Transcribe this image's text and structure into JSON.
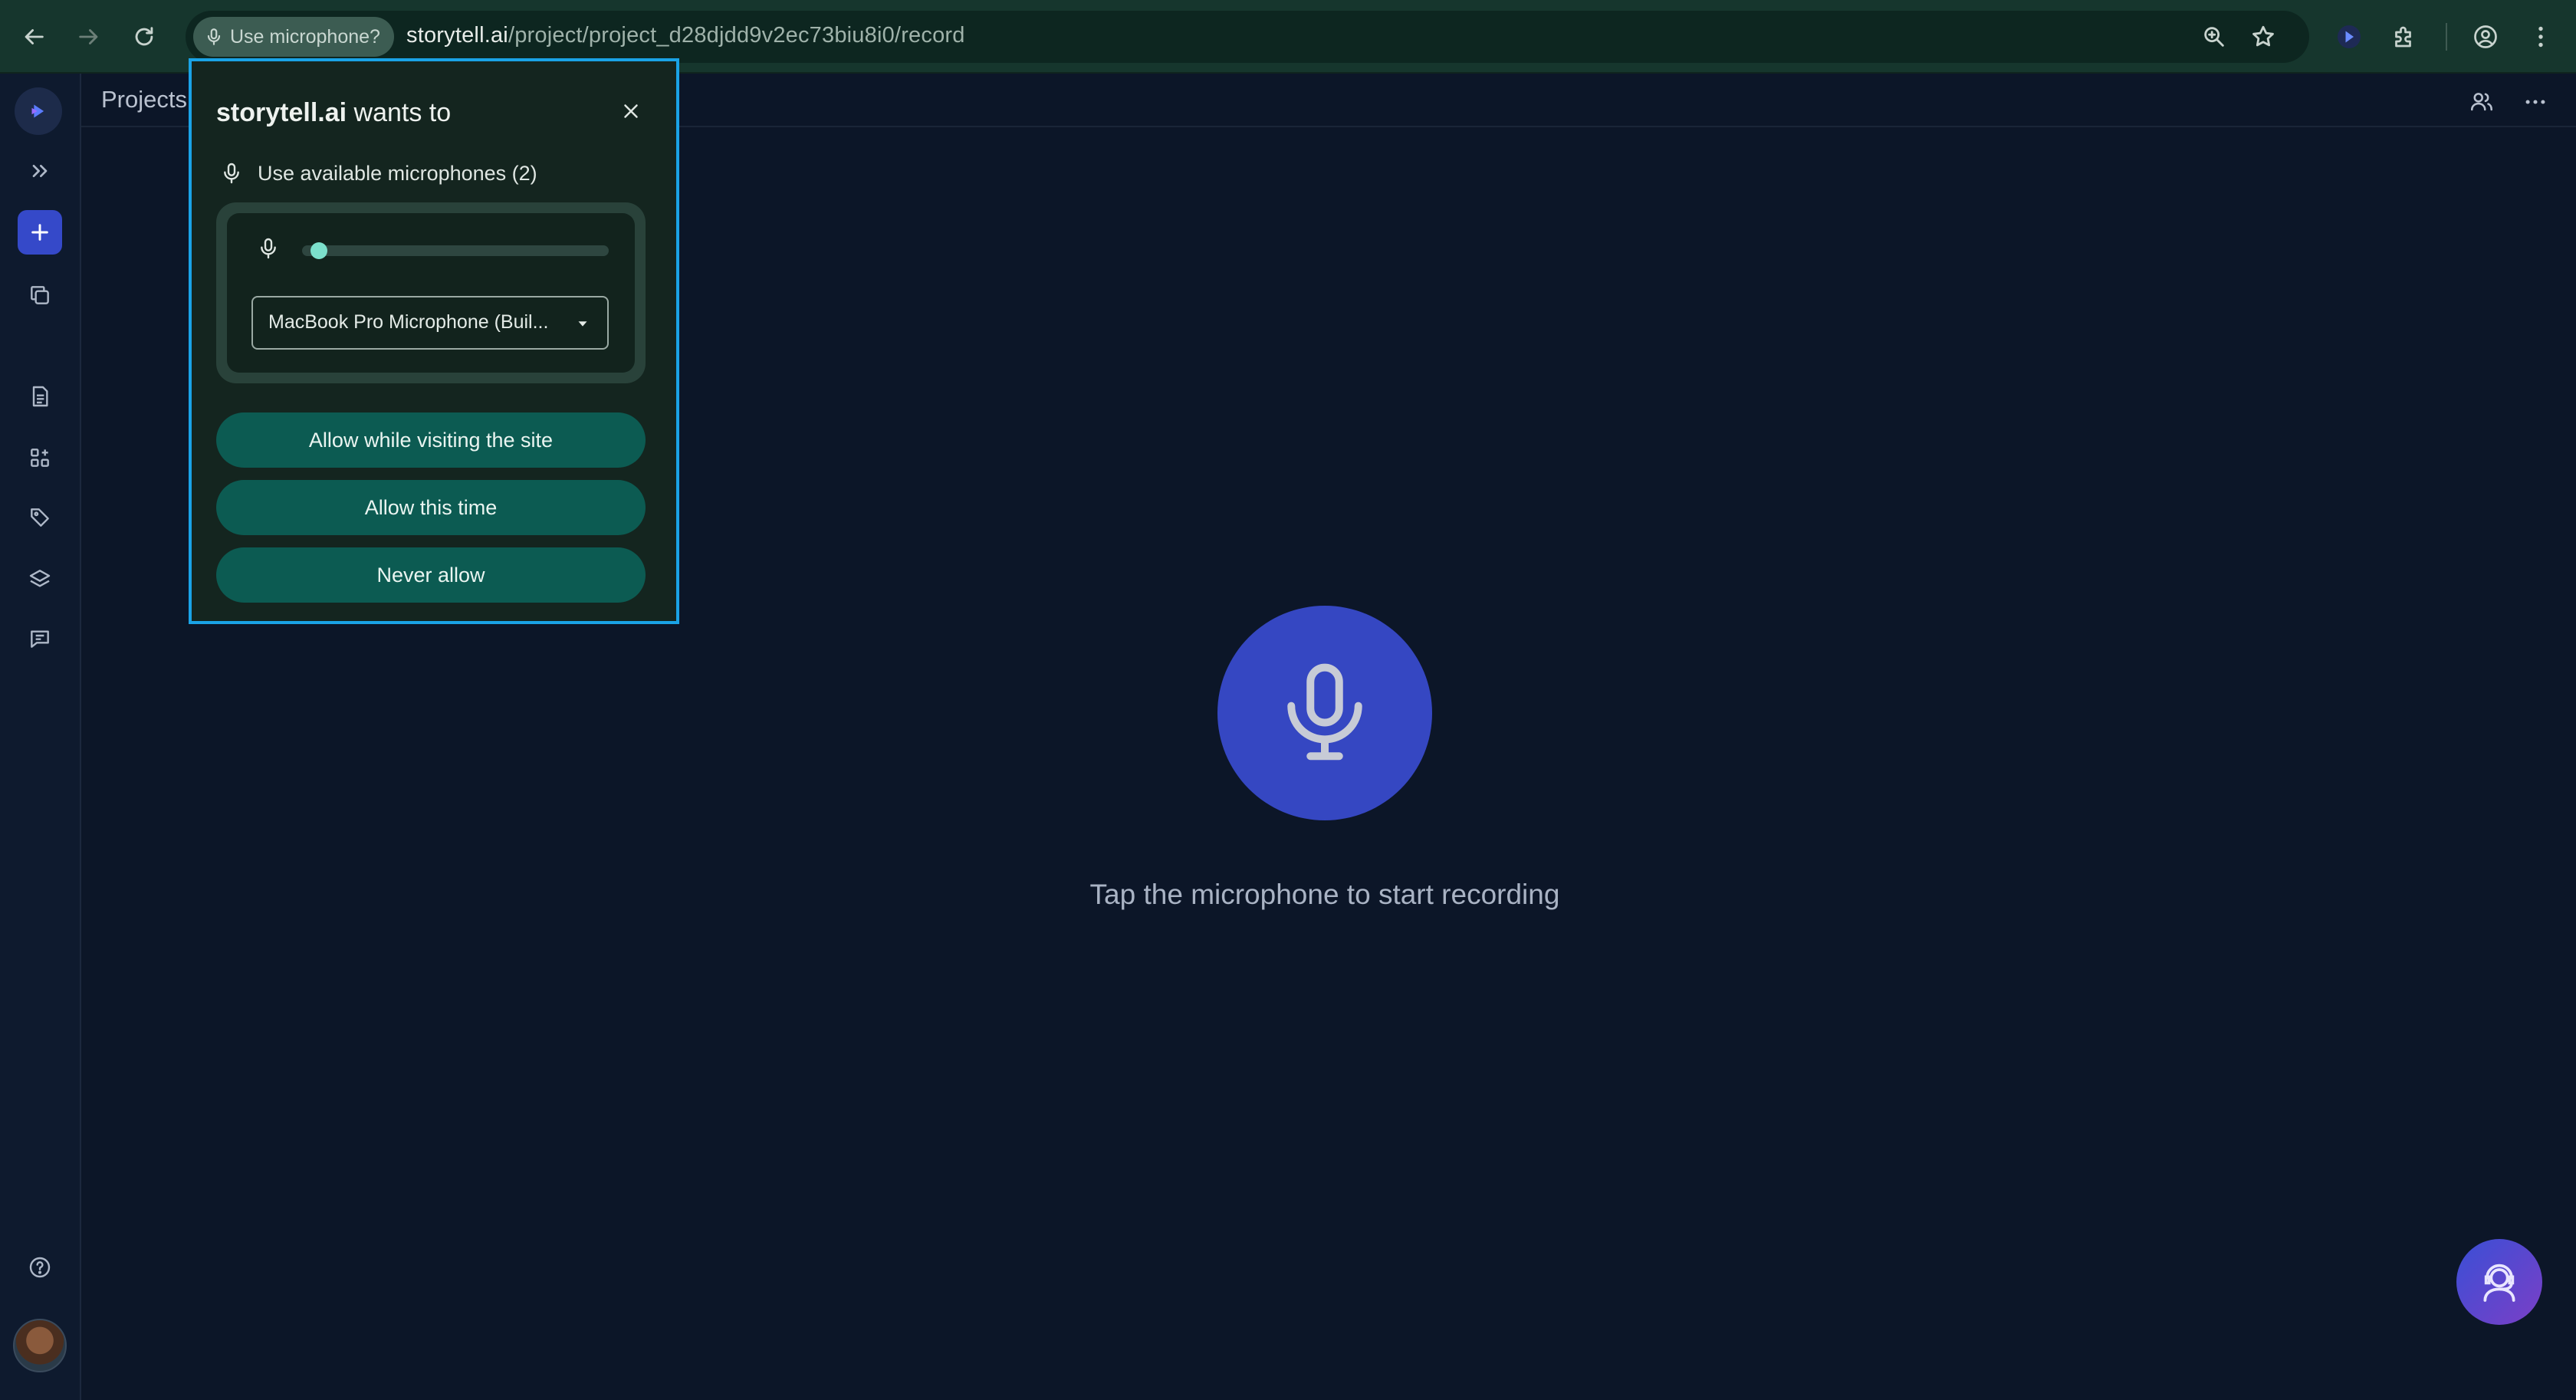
{
  "browser": {
    "permission_chip": "Use microphone?",
    "url_host": "storytell.ai",
    "url_path": "/project/project_d28djdd9v2ec73biu8i0/record",
    "icons": [
      "back-arrow-icon",
      "forward-arrow-icon",
      "reload-icon",
      "zoom-icon",
      "star-icon",
      "storytell-extension-icon",
      "extensions-puzzle-icon",
      "profile-icon",
      "kebab-menu-icon"
    ]
  },
  "sidebar": {
    "items": [
      {
        "name": "logo",
        "icon": "storytell-logo-icon"
      },
      {
        "name": "expand",
        "icon": "double-chevron-right-icon"
      },
      {
        "name": "new",
        "icon": "plus-icon"
      },
      {
        "name": "copy",
        "icon": "copy-icon"
      },
      {
        "name": "documents",
        "icon": "document-icon"
      },
      {
        "name": "apps",
        "icon": "grid-plus-icon"
      },
      {
        "name": "tags",
        "icon": "tag-icon"
      },
      {
        "name": "layers",
        "icon": "layers-icon"
      },
      {
        "name": "chat",
        "icon": "chat-icon"
      },
      {
        "name": "help",
        "icon": "question-circle-icon"
      }
    ]
  },
  "topbar": {
    "breadcrumb": "Projects"
  },
  "main": {
    "hint": "Tap the microphone to start recording"
  },
  "permission_popup": {
    "site": "storytell.ai",
    "title_suffix": " wants to",
    "permission": "Use available microphones (2)",
    "selected_microphone": "MacBook Pro Microphone (Buil...",
    "input_level": 0.03,
    "buttons": {
      "allow_site": "Allow while visiting the site",
      "allow_once": "Allow this time",
      "never": "Never allow"
    }
  },
  "colors": {
    "page_bg": "#0c1628",
    "accent_blue": "#3547c2",
    "popup_focus_border": "#1aa3e6",
    "popup_button": "#0c5b52",
    "chrome_bg": "#16362d"
  }
}
